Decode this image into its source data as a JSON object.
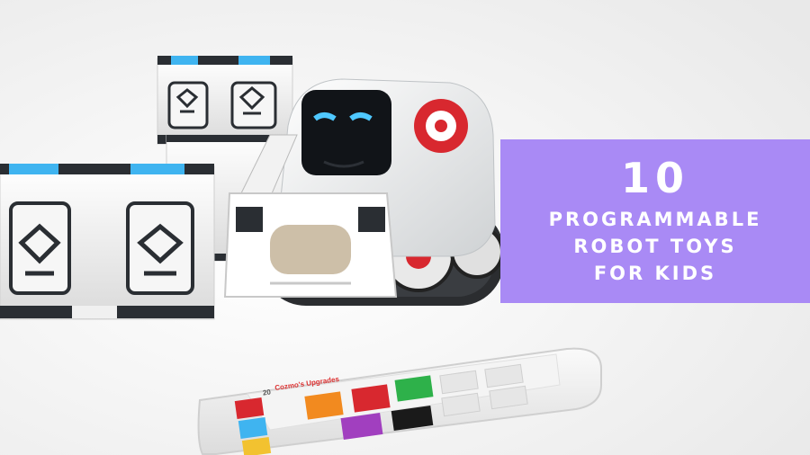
{
  "banner": {
    "number": "10",
    "line1": "PROGRAMMABLE",
    "line2": "ROBOT TOYS",
    "line3": "FOR KIDS",
    "bg_color": "#a98af5"
  },
  "phone": {
    "screen_title": "Cozmo's Upgrades",
    "counter": "20"
  },
  "colors": {
    "robot_red": "#d8282f",
    "cube_light": "#3fb4f0",
    "robot_face": "#111418"
  }
}
